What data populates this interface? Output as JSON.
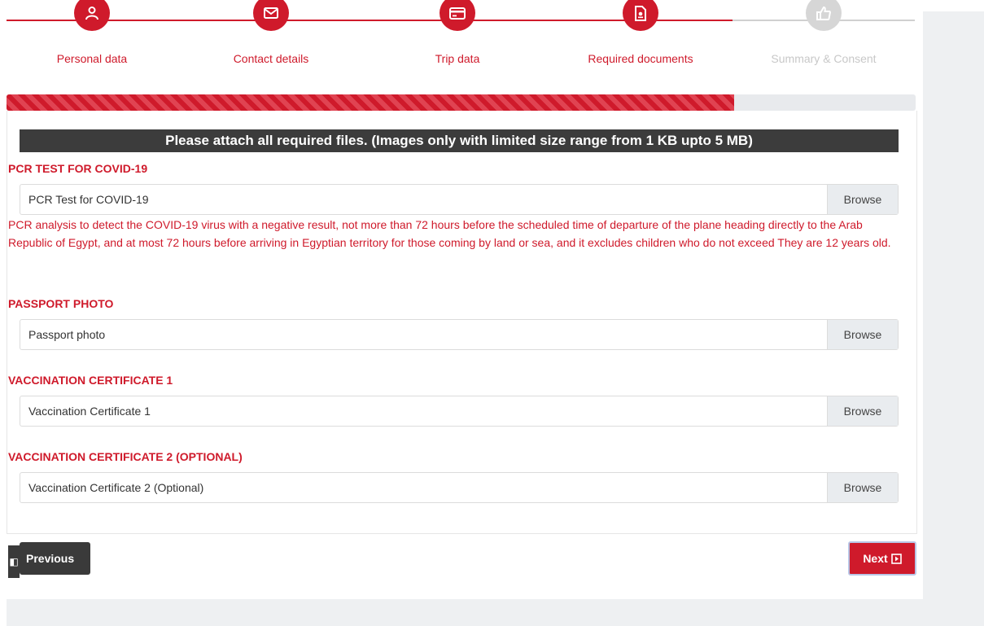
{
  "steps": [
    {
      "label": "Personal data",
      "icon": "user-icon",
      "active": true
    },
    {
      "label": "Contact details",
      "icon": "envelope-icon",
      "active": true
    },
    {
      "label": "Trip data",
      "icon": "card-icon",
      "active": true
    },
    {
      "label": "Required documents",
      "icon": "document-icon",
      "active": true
    },
    {
      "label": "Summary & Consent",
      "icon": "thumbs-up-icon",
      "active": false
    }
  ],
  "progress_fraction": 0.8,
  "notice": "Please attach all required files. (Images only with limited size range from 1 KB upto 5 MB)",
  "sections": {
    "pcr": {
      "title": "PCR TEST FOR COVID-19",
      "file_label": "PCR Test for COVID-19",
      "browse": "Browse",
      "description": "PCR analysis to detect the COVID-19 virus with a negative result, not more than 72 hours before the scheduled time of departure of the plane heading directly to the Arab Republic of Egypt, and at most 72 hours before arriving in Egyptian territory for those coming by land or sea, and it excludes children who do not exceed They are 12 years old."
    },
    "passport": {
      "title": "PASSPORT PHOTO",
      "file_label": "Passport photo",
      "browse": "Browse"
    },
    "vacc1": {
      "title": "VACCINATION CERTIFICATE 1",
      "file_label": "Vaccination Certificate 1",
      "browse": "Browse"
    },
    "vacc2": {
      "title": "VACCINATION CERTIFICATE 2 (OPTIONAL)",
      "file_label": "Vaccination Certificate 2 (Optional)",
      "browse": "Browse"
    }
  },
  "buttons": {
    "previous": "Previous",
    "next": "Next"
  },
  "colors": {
    "accent": "#cf1a2b",
    "dark": "#3a3a3a",
    "inactive": "#d6d6d6"
  }
}
